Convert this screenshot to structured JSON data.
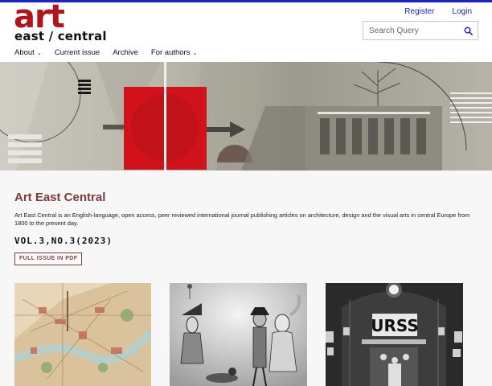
{
  "logo": {
    "word": "art",
    "sub": "east / central"
  },
  "user_links": {
    "register": "Register",
    "login": "Login"
  },
  "search": {
    "placeholder": "Search Query"
  },
  "nav": [
    {
      "label": "About",
      "has_dropdown": true
    },
    {
      "label": "Current issue",
      "has_dropdown": false
    },
    {
      "label": "Archive",
      "has_dropdown": false
    },
    {
      "label": "For authors",
      "has_dropdown": true
    }
  ],
  "journal": {
    "title": "Art East Central",
    "description": "Art East Central is an English-language, open access, peer reviewed international journal publishing articles on architecture, design and the visual arts in central Europe from 1800 to the present day.",
    "issue": "VOL.3,NO.3(2023)",
    "pdf_button": "FULL ISSUE IN PDF"
  },
  "covers": [
    {
      "icon": "map-image-icon"
    },
    {
      "icon": "puppets-photo-icon"
    },
    {
      "icon": "urss-pavilion-photo-icon",
      "sign_text": "URSS"
    }
  ],
  "colors": {
    "accent_blue": "#1a23c9",
    "brand_red": "#b3141b",
    "title_brown": "#7a3b3b"
  }
}
